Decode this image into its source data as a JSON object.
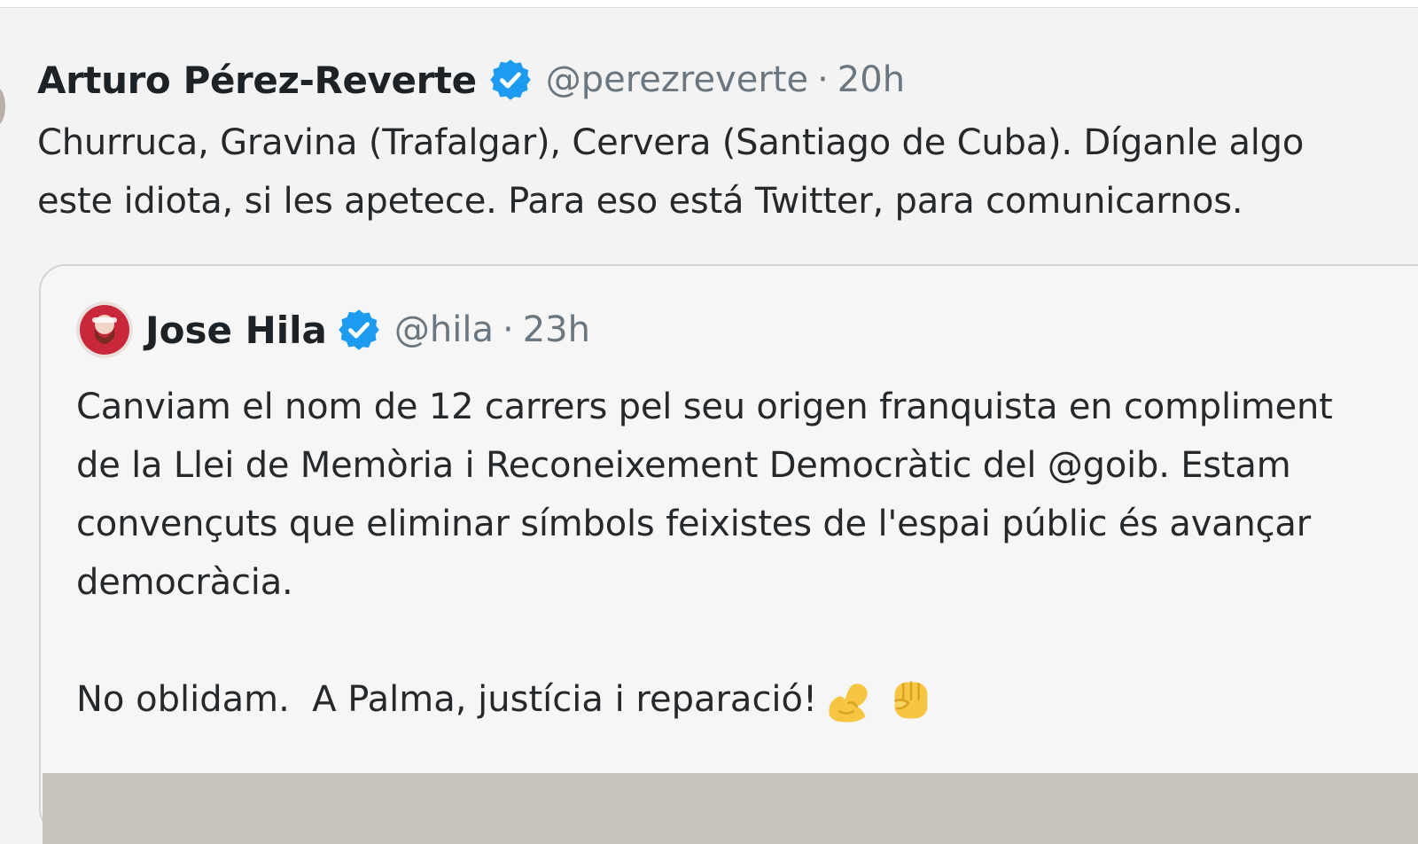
{
  "main_tweet": {
    "author_name": "Arturo Pérez-Reverte",
    "handle": "@perezreverte",
    "separator": "·",
    "time": "20h",
    "text_lines": [
      "Churruca, Gravina (Trafalgar), Cervera (Santiago de Cuba). Díganle algo",
      "este idiota, si les apetece. Para eso está Twitter, para comunicarnos."
    ]
  },
  "quoted_tweet": {
    "author_name": "Jose Hila",
    "handle": "@hila",
    "separator": "·",
    "time": "23h",
    "text_lines": [
      "Canviam el nom de 12 carrers pel seu origen franquista en compliment",
      "de la Llei de Memòria i Reconeixement Democràtic del @goib. Estam",
      "convençuts que eliminar símbols feixistes de l'espai públic és avançar",
      "democràcia."
    ],
    "closing_line": "No oblidam.  A Palma, justícia i reparació!",
    "emojis": [
      "flexed-biceps",
      "raised-fist"
    ]
  },
  "colors": {
    "verified_blue": "#1d9bf0",
    "handle_gray": "#6b7780",
    "emoji_yellow": "#f6c542"
  }
}
